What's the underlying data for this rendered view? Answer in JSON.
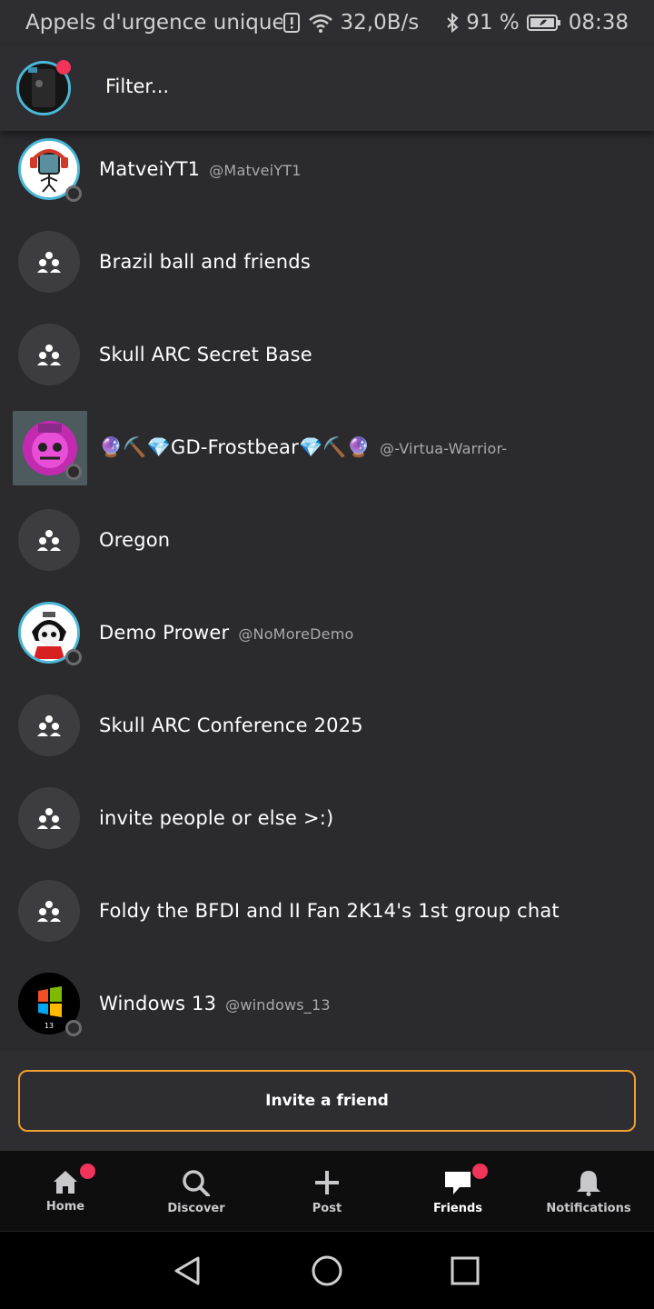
{
  "status_bar": {
    "carrier_text": "Appels d'urgence unique...",
    "speed": "32,0B/s",
    "battery": "91 %",
    "time": "08:38"
  },
  "header": {
    "filter_placeholder": "Filter..."
  },
  "rows": [
    {
      "type": "user",
      "name": "MatveiYT1",
      "handle": "@MatveiYT1"
    },
    {
      "type": "group",
      "name": "Brazil ball and friends"
    },
    {
      "type": "group",
      "name": "Skull ARC Secret Base"
    },
    {
      "type": "user",
      "name": "🔮⛏️💎GD-Frostbear💎⛏️🔮",
      "handle": "@-Virtua-Warrior-"
    },
    {
      "type": "group",
      "name": "Oregon"
    },
    {
      "type": "user",
      "name": "Demo Prower",
      "handle": "@NoMoreDemo"
    },
    {
      "type": "group",
      "name": "Skull ARC Conference 2025"
    },
    {
      "type": "group",
      "name": "invite people or else >:)"
    },
    {
      "type": "group",
      "name": "Foldy the BFDI and II Fan 2K14's 1st group chat"
    },
    {
      "type": "user",
      "name": "Windows 13",
      "handle": "@windows_13"
    }
  ],
  "invite_button": "Invite a friend",
  "tabs": {
    "home": "Home",
    "discover": "Discover",
    "post": "Post",
    "friends": "Friends",
    "notifications": "Notifications"
  },
  "colors": {
    "accent_orange": "#f0a032",
    "badge_red": "#f2335a",
    "background": "#2b2a2d"
  }
}
